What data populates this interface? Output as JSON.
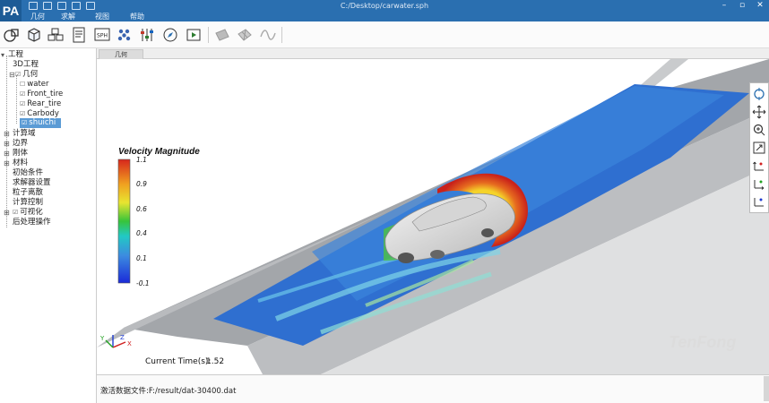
{
  "app": {
    "logo": "PA",
    "window_title": "C:/Desktop/carwater.sph",
    "menu": [
      "几何",
      "求解",
      "视图",
      "帮助"
    ],
    "window_controls": [
      "minimize-icon",
      "restore-icon",
      "close-icon"
    ]
  },
  "toolbar": {
    "icons": [
      "geometry-icon",
      "box-icon",
      "cubes-icon",
      "document-icon",
      "sph-icon",
      "particles-icon",
      "sliders-icon",
      "compass-icon",
      "play-icon",
      "plane-icon",
      "mesh-icon",
      "wave-icon"
    ]
  },
  "tree": {
    "root": "工程",
    "project": "3D工程",
    "geometry": "几何",
    "geometry_items": [
      "water",
      "Front_tire",
      "Rear_tire",
      "Carbody",
      "shuichi"
    ],
    "selected": "shuichi",
    "items": [
      "计算域",
      "边界",
      "刚体",
      "材料",
      "初始条件",
      "求解器设置",
      "粒子离散",
      "计算控制",
      "可视化",
      "后处理操作"
    ]
  },
  "tab": {
    "label": "几何"
  },
  "viewport": {
    "legend_title": "Velocity Magnitude",
    "legend_ticks": [
      "1.1",
      "0.9",
      "0.6",
      "0.4",
      "0.1",
      "-0.1"
    ],
    "time_label": "Current Time(s):",
    "time_value": "1.52",
    "watermark": "TenFong",
    "axes": {
      "x": "X",
      "y": "Y",
      "z": "Z"
    },
    "colors": {
      "road": "#a3a6aa",
      "water_blue": "#2f6fd0",
      "water_red": "#d23a1e"
    }
  },
  "right_tools": [
    "rotate-icon",
    "pan-icon",
    "zoom-icon",
    "fit-icon",
    "view-x-icon",
    "view-y-icon",
    "view-z-icon"
  ],
  "status": {
    "text": "激活数据文件:F:/result/dat-30400.dat"
  }
}
